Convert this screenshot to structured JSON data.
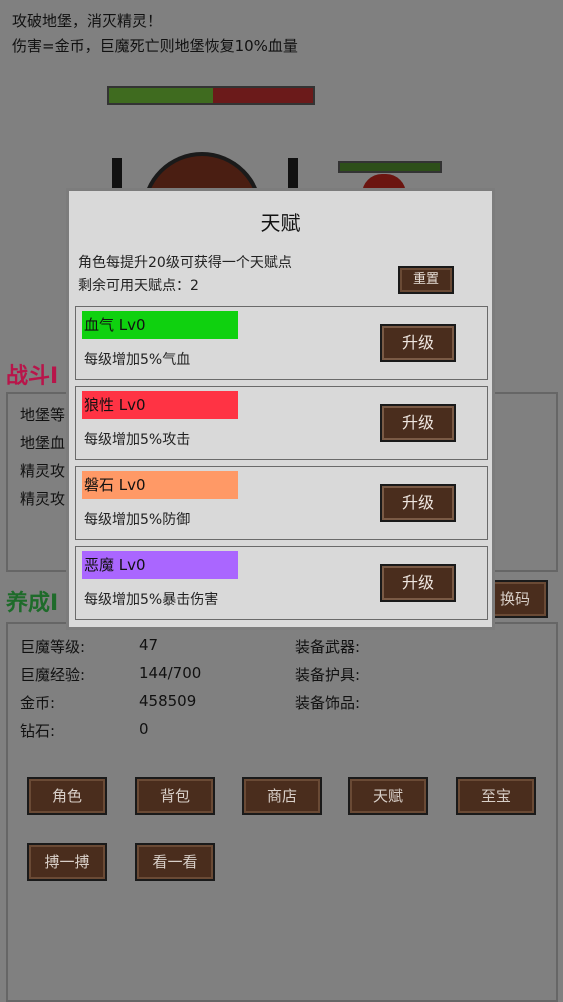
{
  "header": {
    "line1": "攻破地堡，消灭精灵！",
    "line2": "伤害=金币，巨魔死亡则地堡恢复10%血量",
    "castle_hp_fraction": 0.51
  },
  "battle": {
    "title_partial": "战斗I",
    "rows": [
      "地堡等",
      "地堡血",
      "精灵攻",
      "精灵攻"
    ]
  },
  "develop": {
    "title_partial": "养成I",
    "code_button": "换码",
    "stats_left": [
      {
        "label": "巨魔等级:",
        "value": "47"
      },
      {
        "label": "巨魔经验:",
        "value": "144/700"
      },
      {
        "label": "金币:",
        "value": "458509"
      },
      {
        "label": "钻石:",
        "value": "0"
      }
    ],
    "stats_right": [
      "装备武器:",
      "装备护具:",
      "装备饰品:"
    ],
    "buttons_row1": [
      "角色",
      "背包",
      "商店",
      "天赋",
      "至宝"
    ],
    "buttons_row2": [
      "搏一搏",
      "看一看"
    ]
  },
  "talent_dialog": {
    "title": "天赋",
    "info1": "角色每提升20级可获得一个天赋点",
    "info2": "剩余可用天赋点：2",
    "reset": "重置",
    "talents": [
      {
        "name": "血气 Lv0",
        "desc": "每级增加5%气血",
        "color": "#0fd10f",
        "button": "升级"
      },
      {
        "name": "狼性 Lv0",
        "desc": "每级增加5%攻击",
        "color": "#ff3344",
        "button": "升级"
      },
      {
        "name": "磐石 Lv0",
        "desc": "每级增加5%防御",
        "color": "#ff9966",
        "button": "升级"
      },
      {
        "name": "恶魔 Lv0",
        "desc": "每级增加5%暴击伤害",
        "color": "#aa66ff",
        "button": "升级"
      }
    ]
  }
}
